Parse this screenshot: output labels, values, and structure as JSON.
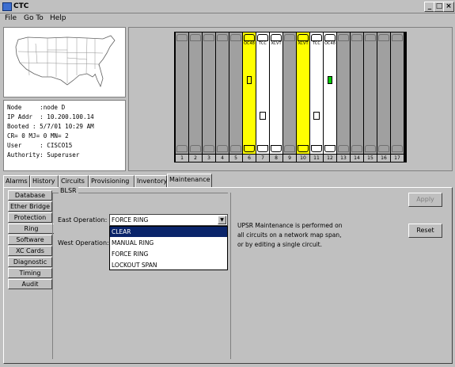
{
  "window": {
    "title": "CTC"
  },
  "window_controls": [
    "minimize",
    "maximize",
    "close"
  ],
  "menu": [
    {
      "label": "File"
    },
    {
      "label": "Go To"
    },
    {
      "label": "Help"
    }
  ],
  "node_info": {
    "lines": [
      "Node     :node D",
      "IP Addr  : 10.200.100.14",
      "Booted : 5/7/01 10:29 AM",
      "CR= 0 MJ= 0 MN= 2",
      "User     : CISCO15",
      "Authority: Superuser"
    ]
  },
  "shelf": {
    "slots": [
      {
        "num": "1",
        "type": "empty"
      },
      {
        "num": "2",
        "type": "empty"
      },
      {
        "num": "3",
        "type": "empty"
      },
      {
        "num": "4",
        "type": "empty"
      },
      {
        "num": "5",
        "type": "empty"
      },
      {
        "num": "6",
        "type": "card-y",
        "label": "OC48"
      },
      {
        "num": "7",
        "type": "card-w",
        "label": "TCC"
      },
      {
        "num": "8",
        "type": "card-w",
        "label": "XCVT"
      },
      {
        "num": "9",
        "type": "empty"
      },
      {
        "num": "10",
        "type": "card-y",
        "label": "XCVT"
      },
      {
        "num": "11",
        "type": "card-w",
        "label": "TCC"
      },
      {
        "num": "12",
        "type": "card-w",
        "label": "OC48"
      },
      {
        "num": "13",
        "type": "empty"
      },
      {
        "num": "14",
        "type": "empty"
      },
      {
        "num": "15",
        "type": "empty"
      },
      {
        "num": "16",
        "type": "empty"
      },
      {
        "num": "17",
        "type": "empty"
      }
    ]
  },
  "tabs": [
    {
      "label": "Alarms"
    },
    {
      "label": "History"
    },
    {
      "label": "Circuits"
    },
    {
      "label": "Provisioning"
    },
    {
      "label": "Inventory"
    },
    {
      "label": "Maintenance",
      "active": true
    }
  ],
  "subtabs": [
    {
      "label": "Database"
    },
    {
      "label": "Ether Bridge"
    },
    {
      "label": "Protection"
    },
    {
      "label": "Ring",
      "active": true
    },
    {
      "label": "Software"
    },
    {
      "label": "XC Cards"
    },
    {
      "label": "Diagnostic"
    },
    {
      "label": "Timing"
    },
    {
      "label": "Audit"
    }
  ],
  "blsr": {
    "group_label": "BLSR",
    "east_label": "East Operation:",
    "east_value": "FORCE RING",
    "west_label": "West Operation:",
    "options": [
      "CLEAR",
      "MANUAL RING",
      "FORCE RING",
      "LOCKOUT SPAN"
    ],
    "highlighted_option": "CLEAR"
  },
  "upsr_info": {
    "lines": [
      "UPSR Maintenance is performed on",
      "all circuits on a network map span,",
      "or by editing a single circuit."
    ]
  },
  "buttons": {
    "apply": "Apply",
    "reset": "Reset"
  },
  "colors": {
    "background": "#c0c0c0",
    "card_active": "#ffff00",
    "selection": "#0a246a",
    "status_led": "#00cc00"
  }
}
